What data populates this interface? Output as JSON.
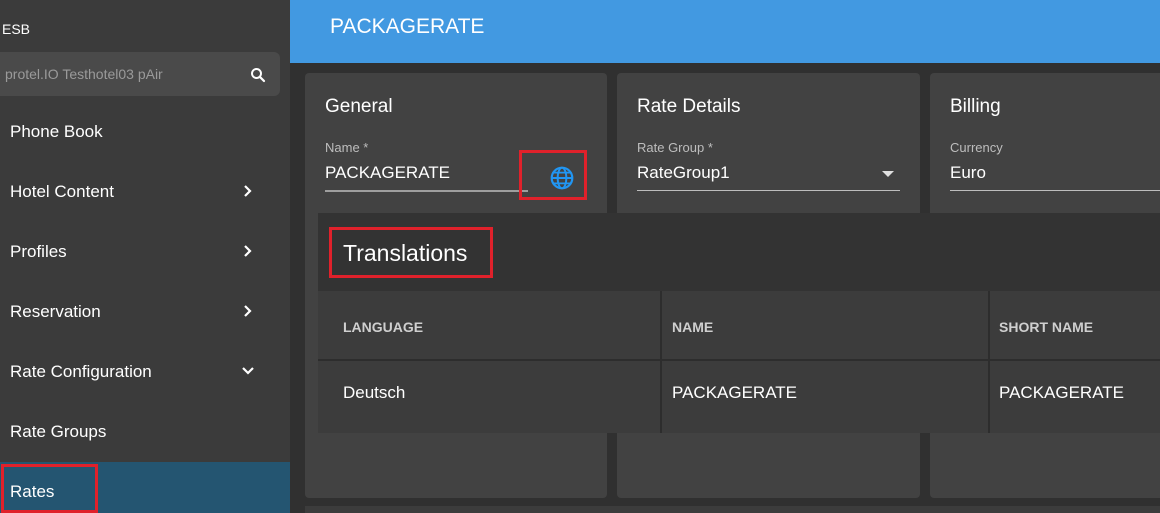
{
  "app": {
    "brand": "ESB"
  },
  "search": {
    "value": "protel.IO Testhotel03 pAir"
  },
  "sidebar": {
    "items": [
      {
        "label": "Phone Book"
      },
      {
        "label": "Hotel Content"
      },
      {
        "label": "Profiles"
      },
      {
        "label": "Reservation"
      },
      {
        "label": "Rate Configuration"
      },
      {
        "label": "Rate Groups"
      },
      {
        "label": "Rates"
      }
    ]
  },
  "header": {
    "title": "PACKAGERATE"
  },
  "general": {
    "title": "General",
    "name_label": "Name *",
    "name_value": "PACKAGERATE"
  },
  "rate_details": {
    "title": "Rate Details",
    "rate_group_label": "Rate Group *",
    "rate_group_value": "RateGroup1"
  },
  "billing": {
    "title": "Billing",
    "currency_label": "Currency",
    "currency_value": "Euro"
  },
  "translations": {
    "title": "Translations",
    "columns": [
      "LANGUAGE",
      "NAME",
      "SHORT NAME"
    ],
    "rows": [
      [
        "Deutsch",
        "PACKAGERATE",
        "PACKAGERATE"
      ]
    ]
  },
  "colors": {
    "header": "#4299e1",
    "sidebar_active": "#245571",
    "highlight": "#e0212b"
  }
}
